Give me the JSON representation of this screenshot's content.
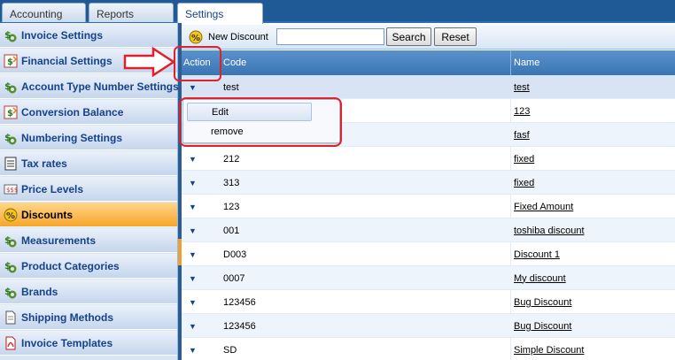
{
  "tabs": [
    {
      "label": "Accounting",
      "active": false
    },
    {
      "label": "Reports",
      "active": false
    },
    {
      "label": "Settings",
      "active": true
    }
  ],
  "sidebar": {
    "items": [
      {
        "label": "Invoice Settings",
        "icon": "dollar-gear-icon"
      },
      {
        "label": "Financial Settings",
        "icon": "dollar-arrows-icon"
      },
      {
        "label": "Account Type Number Settings",
        "icon": "dollar-gear-icon"
      },
      {
        "label": "Conversion Balance",
        "icon": "dollar-arrows-icon"
      },
      {
        "label": "Numbering Settings",
        "icon": "dollar-gear-icon"
      },
      {
        "label": "Tax rates",
        "icon": "list-icon"
      },
      {
        "label": "Price Levels",
        "icon": "price-tag-icon"
      },
      {
        "label": "Discounts",
        "icon": "percent-icon",
        "active": true
      },
      {
        "label": "Measurements",
        "icon": "dollar-gear-icon"
      },
      {
        "label": "Product Categories",
        "icon": "dollar-gear-icon"
      },
      {
        "label": "Brands",
        "icon": "dollar-gear-icon"
      },
      {
        "label": "Shipping Methods",
        "icon": "document-icon"
      },
      {
        "label": "Invoice Templates",
        "icon": "pdf-icon"
      }
    ]
  },
  "toolbar": {
    "new_label": "New Discount",
    "search_value": "",
    "search_label": "Search",
    "reset_label": "Reset"
  },
  "grid": {
    "columns": [
      "Action",
      "Code",
      "Name"
    ],
    "rows": [
      {
        "code": "test",
        "name": "test"
      },
      {
        "code": "",
        "name": "123"
      },
      {
        "code": "",
        "name": "fasf"
      },
      {
        "code": "212",
        "name": "fixed"
      },
      {
        "code": "313",
        "name": "fixed"
      },
      {
        "code": "123",
        "name": "Fixed Amount"
      },
      {
        "code": "001",
        "name": "toshiba discount"
      },
      {
        "code": "D003",
        "name": "Discount 1"
      },
      {
        "code": "0007",
        "name": "My discount"
      },
      {
        "code": "123456",
        "name": "Bug Discount"
      },
      {
        "code": "123456",
        "name": "Bug Discount"
      },
      {
        "code": "SD",
        "name": "Simple Discount"
      }
    ]
  },
  "context_menu": {
    "items": [
      "Edit",
      "remove"
    ]
  },
  "annotation_color": "#e0202a",
  "accent": "#1f5a96"
}
